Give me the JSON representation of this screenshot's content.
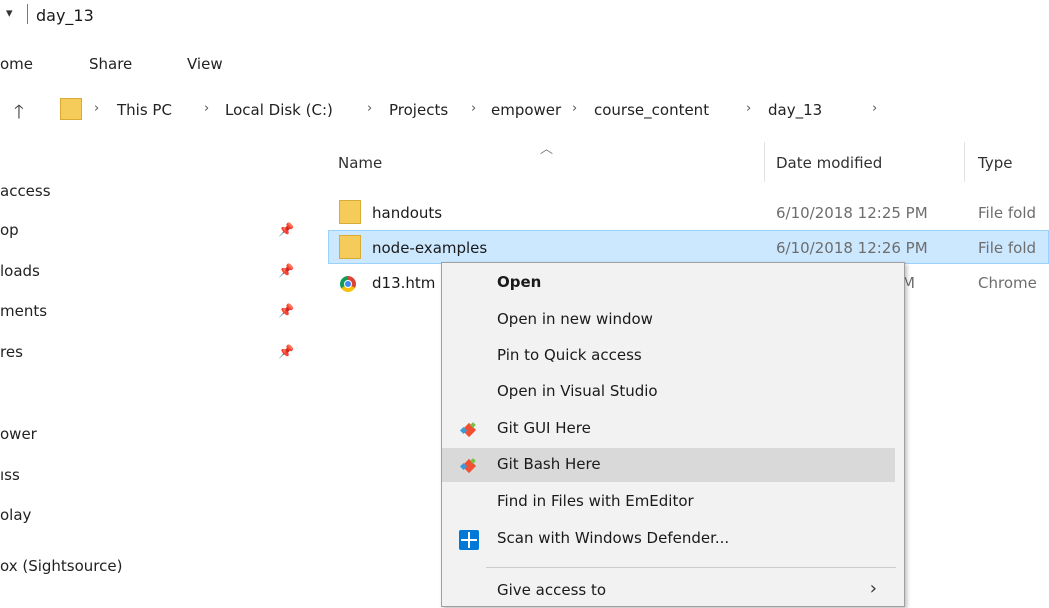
{
  "window": {
    "title": "day_13"
  },
  "ribbon": {
    "tabs": [
      "ome",
      "Share",
      "View"
    ]
  },
  "address": {
    "crumbs": [
      "This PC",
      "Local Disk (C:)",
      "Projects",
      "empower",
      "course_content",
      "day_13"
    ]
  },
  "nav": {
    "items": [
      {
        "label": "access",
        "pinned": false
      },
      {
        "label": "op",
        "pinned": true
      },
      {
        "label": "loads",
        "pinned": true
      },
      {
        "label": "ments",
        "pinned": true
      },
      {
        "label": "res",
        "pinned": true
      },
      {
        "label": "ower",
        "pinned": false
      },
      {
        "label": "ıss",
        "pinned": false
      },
      {
        "label": "olay",
        "pinned": false
      },
      {
        "label": "ox (Sightsource)",
        "pinned": false
      }
    ]
  },
  "columns": {
    "name": "Name",
    "date": "Date modified",
    "type": "Type"
  },
  "files": [
    {
      "name": "handouts",
      "date": "6/10/2018 12:25 PM",
      "type": "File fold",
      "icon": "folder-icon"
    },
    {
      "name": "node-examples",
      "date": "6/10/2018 12:26 PM",
      "type": "File fold",
      "icon": "folder-icon",
      "selected": true
    },
    {
      "name": "d13.htm",
      "date": "PM",
      "type": "Chrome",
      "icon": "chrome-icon"
    }
  ],
  "context_menu": {
    "items": [
      {
        "label": "Open",
        "bold": true
      },
      {
        "label": "Open in new window"
      },
      {
        "label": "Pin to Quick access"
      },
      {
        "label": "Open in Visual Studio"
      },
      {
        "label": "Git GUI Here",
        "icon": "git-gui-icon"
      },
      {
        "label": "Git Bash Here",
        "icon": "git-bash-icon",
        "highlighted": true
      },
      {
        "label": "Find in Files with EmEditor"
      },
      {
        "label": "Scan with Windows Defender...",
        "icon": "windows-defender-icon"
      },
      {
        "label": "Give access to",
        "submenu": true
      }
    ]
  },
  "colors": {
    "selection": "#cce8ff",
    "selection_border": "#99d1ff",
    "menu_bg": "#f2f2f2",
    "menu_highlight": "#d9d9d9",
    "folder": "#f5cc5a"
  }
}
